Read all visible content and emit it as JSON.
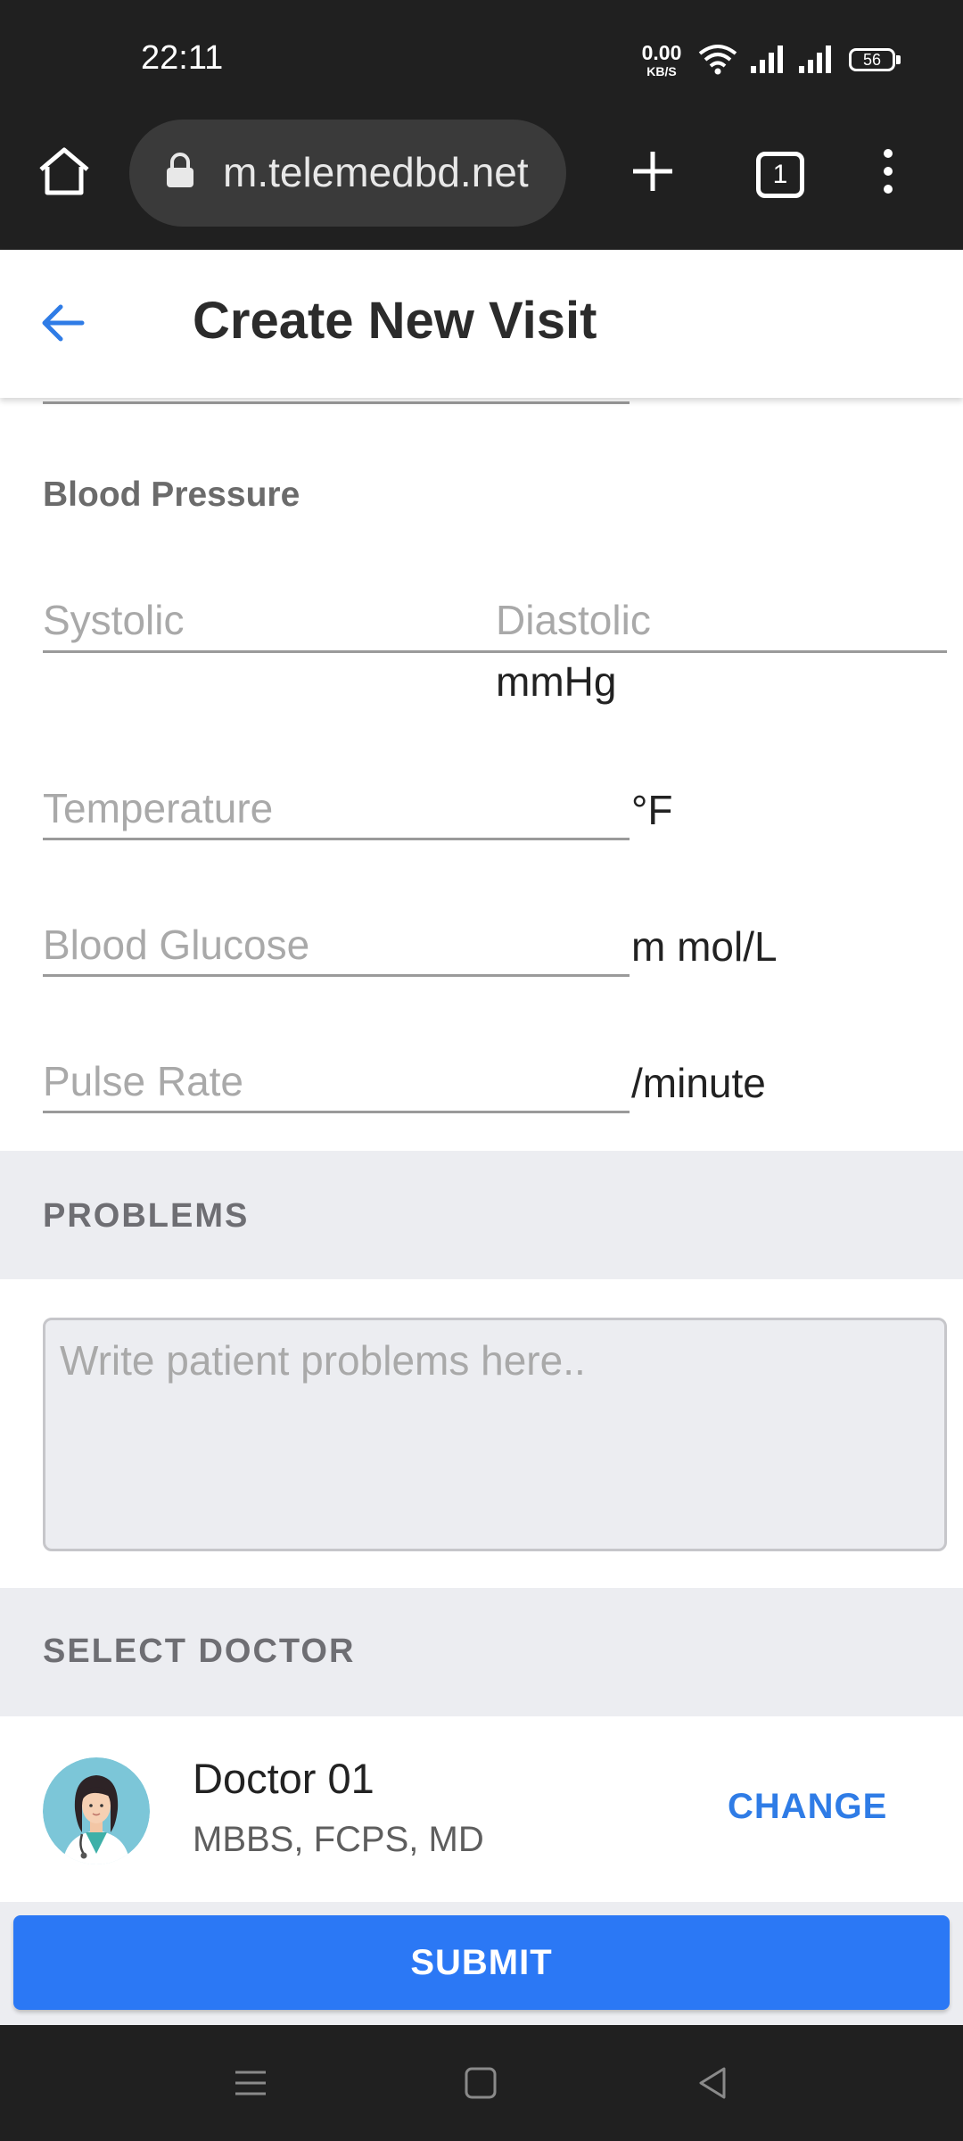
{
  "status_bar": {
    "time": "22:11",
    "net_speed_value": "0.00",
    "net_speed_unit": "KB/S",
    "battery": "56"
  },
  "browser": {
    "url": "m.telemedbd.net",
    "tab_count": "1"
  },
  "header": {
    "title": "Create New Visit"
  },
  "vitals": {
    "blood_pressure_label": "Blood Pressure",
    "systolic_placeholder": "Systolic",
    "diastolic_placeholder": "Diastolic",
    "bp_unit": "mmHg",
    "temperature_placeholder": "Temperature",
    "temperature_unit": "°F",
    "glucose_placeholder": "Blood Glucose",
    "glucose_unit": "m mol/L",
    "pulse_placeholder": "Pulse Rate",
    "pulse_unit": "/minute"
  },
  "problems": {
    "section_label": "PROBLEMS",
    "placeholder": "Write patient problems here.."
  },
  "doctor": {
    "section_label": "SELECT DOCTOR",
    "name": "Doctor 01",
    "degrees": "MBBS, FCPS, MD",
    "change_label": "CHANGE"
  },
  "submit_label": "SUBMIT",
  "colors": {
    "accent": "#2b78f5",
    "link": "#2f7ce6",
    "band": "#ecedf1",
    "system_bar": "#202020"
  }
}
